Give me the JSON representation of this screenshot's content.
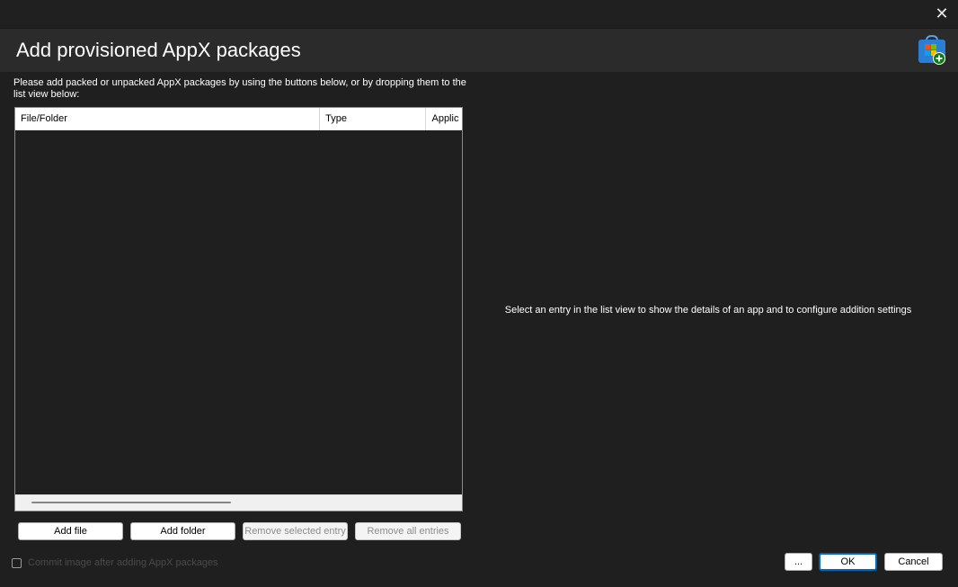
{
  "window": {
    "close_glyph": "✕",
    "title": "Add provisioned AppX packages",
    "icon": "store-bag-plus-icon"
  },
  "instructions": "Please add packed or unpacked AppX packages by using the buttons below, or by dropping them to the list view below:",
  "listview": {
    "columns": [
      "File/Folder",
      "Type",
      "Applic"
    ],
    "rows": []
  },
  "buttons": {
    "add_file": "Add file",
    "add_folder": "Add folder",
    "remove_selected": "Remove selected entry",
    "remove_all": "Remove all entries",
    "ellipsis": "...",
    "ok": "OK",
    "cancel": "Cancel"
  },
  "details_placeholder": "Select an entry in the list view to show the details of an app and to configure addition settings",
  "commit_checkbox": {
    "label": "Commit image after adding AppX packages",
    "checked": false
  },
  "colors": {
    "background": "#1f1f1f",
    "header": "#2b2b2b",
    "accent": "#0067c0"
  }
}
